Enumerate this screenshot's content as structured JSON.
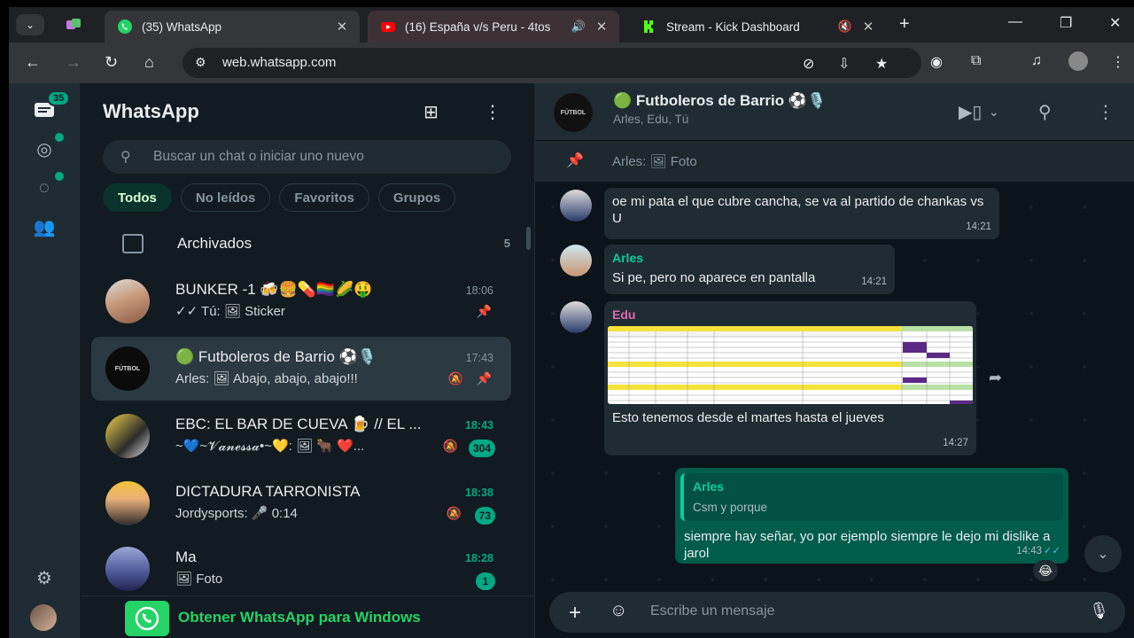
{
  "browser": {
    "tabs": [
      {
        "title": "(35) WhatsApp",
        "active": true
      },
      {
        "title": "(16) España v/s Peru - 4tos",
        "active": false
      },
      {
        "title": "Stream - Kick Dashboard",
        "active": false
      }
    ],
    "url": "web.whatsapp.com"
  },
  "colors": {
    "accent": "#00a884",
    "bubble_out": "#005c4b",
    "bubble_in": "#202c33"
  },
  "rail": {
    "chats_badge": "35"
  },
  "sidebar": {
    "title": "WhatsApp",
    "search_placeholder": "Buscar un chat o iniciar uno nuevo",
    "filters": [
      "Todos",
      "No leídos",
      "Favoritos",
      "Grupos"
    ],
    "archived_label": "Archivados",
    "archived_count": "5",
    "chats": [
      {
        "name": "BUNKER -1 🍻🍔💊🏳️‍🌈🌽🤑",
        "time": "18:06",
        "preview": "✓✓ Tú: 🖼 Sticker"
      },
      {
        "name": "🟢 Futboleros de Barrio ⚽🎙️",
        "time": "17:43",
        "preview": "Arles: 🖼 Abajo, abajo, abajo!!!"
      },
      {
        "name": "EBC: EL BAR DE CUEVA 🍺 // EL ...",
        "time": "18:43",
        "preview": "~💙~𝓥𝓪𝓷𝓮𝓼𝓼𝓪•~💛: 🖼 🐂 ❤️...",
        "badge": "304"
      },
      {
        "name": "DICTADURA TARRONISTA",
        "time": "18:38",
        "preview": "Jordysports: 🎤 0:14",
        "badge": "73"
      },
      {
        "name": "Ma",
        "time": "18:28",
        "preview": "🖼 Foto",
        "badge": "1"
      }
    ],
    "get_app": "Obtener WhatsApp para Windows"
  },
  "conversation": {
    "name": "🟢 Futboleros de Barrio ⚽🎙️",
    "members": "Arles, Edu, Tú",
    "pinned": "Arles: 🖼 Foto",
    "messages": [
      {
        "text": "oe mi pata el que cubre cancha, se va al partido de chankas vs U",
        "time": "14:21"
      },
      {
        "sender": "Arles",
        "text": "Si pe, pero no aparece en pantalla",
        "time": "14:21"
      },
      {
        "sender": "Edu",
        "text": "Esto tenemos desde el martes hasta el jueves",
        "time": "14:27"
      },
      {
        "quote_sender": "Arles",
        "quote_text": "Csm y porque",
        "text": "siempre hay señar, yo por ejemplo siempre le dejo mi dislike a jarol",
        "time": "14:43"
      }
    ],
    "reaction": "😂",
    "input_placeholder": "Escribe un mensaje"
  }
}
